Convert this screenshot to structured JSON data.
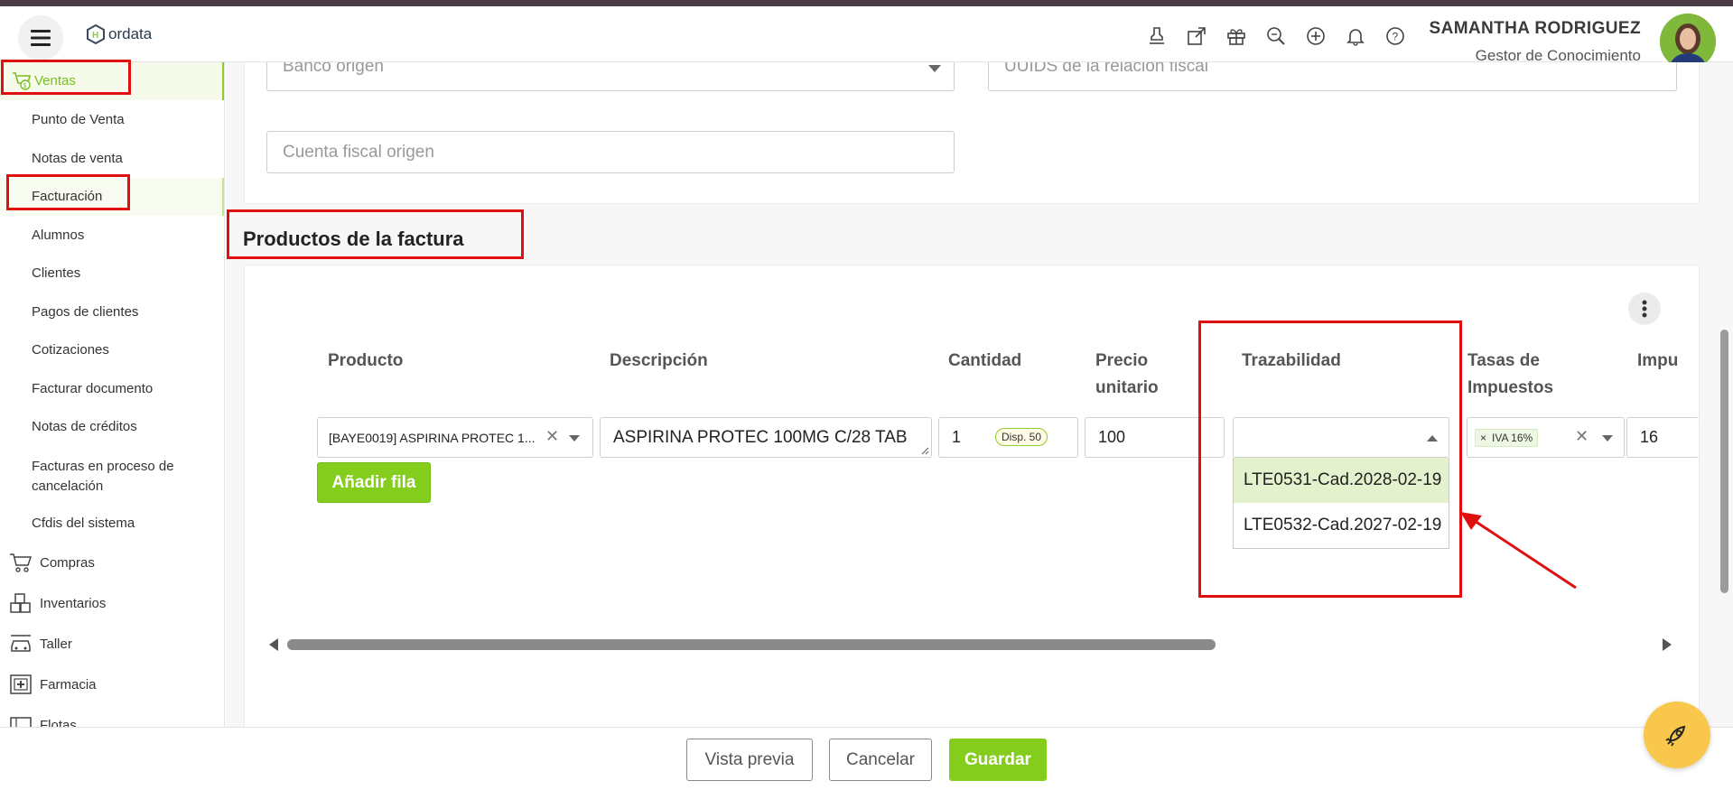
{
  "header": {
    "logo_text": "ordata",
    "user_name": "SAMANTHA RODRIGUEZ",
    "user_role": "Gestor de Conocimiento",
    "icons": [
      "stamp-icon",
      "external-link-icon",
      "gift-icon",
      "search-zoom-icon",
      "plus-circle-icon",
      "bell-icon",
      "help-icon"
    ]
  },
  "sidebar": {
    "section": "Ventas",
    "sub_items": [
      "Punto de Venta",
      "Notas de venta",
      "Facturación",
      "Alumnos",
      "Clientes",
      "Pagos de clientes",
      "Cotizaciones",
      "Facturar documento",
      "Notas de créditos",
      "Facturas en proceso de cancelación",
      "Cfdis del sistema"
    ],
    "main_items": [
      "Compras",
      "Inventarios",
      "Taller",
      "Farmacia",
      "Flotas"
    ]
  },
  "form": {
    "banco_origen_placeholder": "Banco origen",
    "uuids_placeholder": "UUIDS de la relación fiscal",
    "cuenta_fiscal_placeholder": "Cuenta fiscal origen"
  },
  "products": {
    "section_title": "Productos de la factura",
    "columns": {
      "producto": "Producto",
      "descripcion": "Descripción",
      "cantidad": "Cantidad",
      "precio_line1": "Precio",
      "precio_line2": "unitario",
      "trazabilidad": "Trazabilidad",
      "tasas_line1": "Tasas de",
      "tasas_line2": "Impuestos",
      "impuestos_partial": "Impu"
    },
    "row": {
      "producto": "[BAYE0019] ASPIRINA PROTEC 1...",
      "descripcion": "ASPIRINA PROTEC 100MG C/28 TAB",
      "cantidad": "1",
      "disponible": "Disp. 50",
      "precio": "100",
      "tasa_tag": "IVA 16%",
      "impuesto": "16"
    },
    "add_row_label": "Añadir fila",
    "trazabilidad_options": [
      "LTE0531-Cad.2028-02-19",
      "LTE0532-Cad.2027-02-19"
    ]
  },
  "footer": {
    "preview_label": "Vista previa",
    "cancel_label": "Cancelar",
    "save_label": "Guardar"
  },
  "colors": {
    "accent_green": "#84cd1c",
    "annotation_red": "#e01010",
    "fab_yellow": "#f9c74b"
  }
}
